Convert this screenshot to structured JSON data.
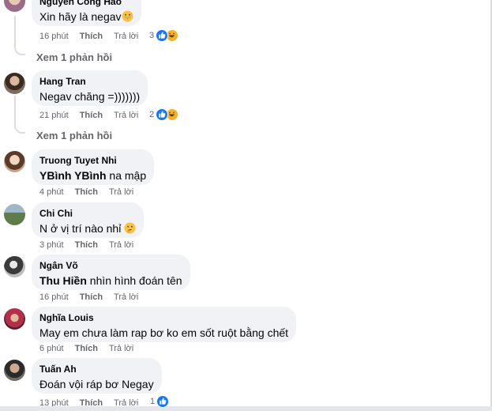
{
  "comments": [
    {
      "author": "Nguyễn Công Hào",
      "text": "Xin hãy là negav",
      "emoji": "grin-emoji",
      "time": "16 phút",
      "like": "Thích",
      "reply": "Trả lời",
      "reaction_count": "3",
      "reactions": [
        "like-reaction-icon",
        "haha-reaction-icon"
      ],
      "view_replies": "Xem 1 phản hồi"
    },
    {
      "author": "Hang Tran",
      "text": "Negav chăng =)))))))",
      "time": "21 phút",
      "like": "Thích",
      "reply": "Trả lời",
      "reaction_count": "2",
      "reactions": [
        "like-reaction-icon",
        "haha-reaction-icon"
      ],
      "view_replies": "Xem 1 phản hồi"
    },
    {
      "author": "Truong Tuyet Nhi",
      "mention": "YBình YBình",
      "text": " na mập",
      "time": "4 phút",
      "like": "Thích",
      "reply": "Trả lời"
    },
    {
      "author": "Chi Chi",
      "text": "N ở vị trí nào nhỉ",
      "emoji": "thinking-face-emoji",
      "time": "3 phút",
      "like": "Thích",
      "reply": "Trả lời"
    },
    {
      "author": "Ngân Võ",
      "mention": "Thu Hiền",
      "text": " nhìn hình đoán tên",
      "time": "16 phút",
      "like": "Thích",
      "reply": "Trả lời"
    },
    {
      "author": "Nghĩa Louis",
      "text": "May em chưa làm rap bơ ko em sốt ruột bằng chết",
      "time": "6 phút",
      "like": "Thích",
      "reply": "Trả lời"
    },
    {
      "author": "Tuấn Ah",
      "text": "Đoán vội ráp bơ Negay",
      "time": "13 phút",
      "like": "Thích",
      "reply": "Trả lời",
      "reaction_count": "1",
      "reactions": [
        "like-reaction-icon"
      ]
    }
  ],
  "colors": {
    "bubble": "#f0f2f5",
    "meta": "#65676b",
    "like_blue": "#1877f2",
    "haha_yellow": "#f7b125"
  }
}
